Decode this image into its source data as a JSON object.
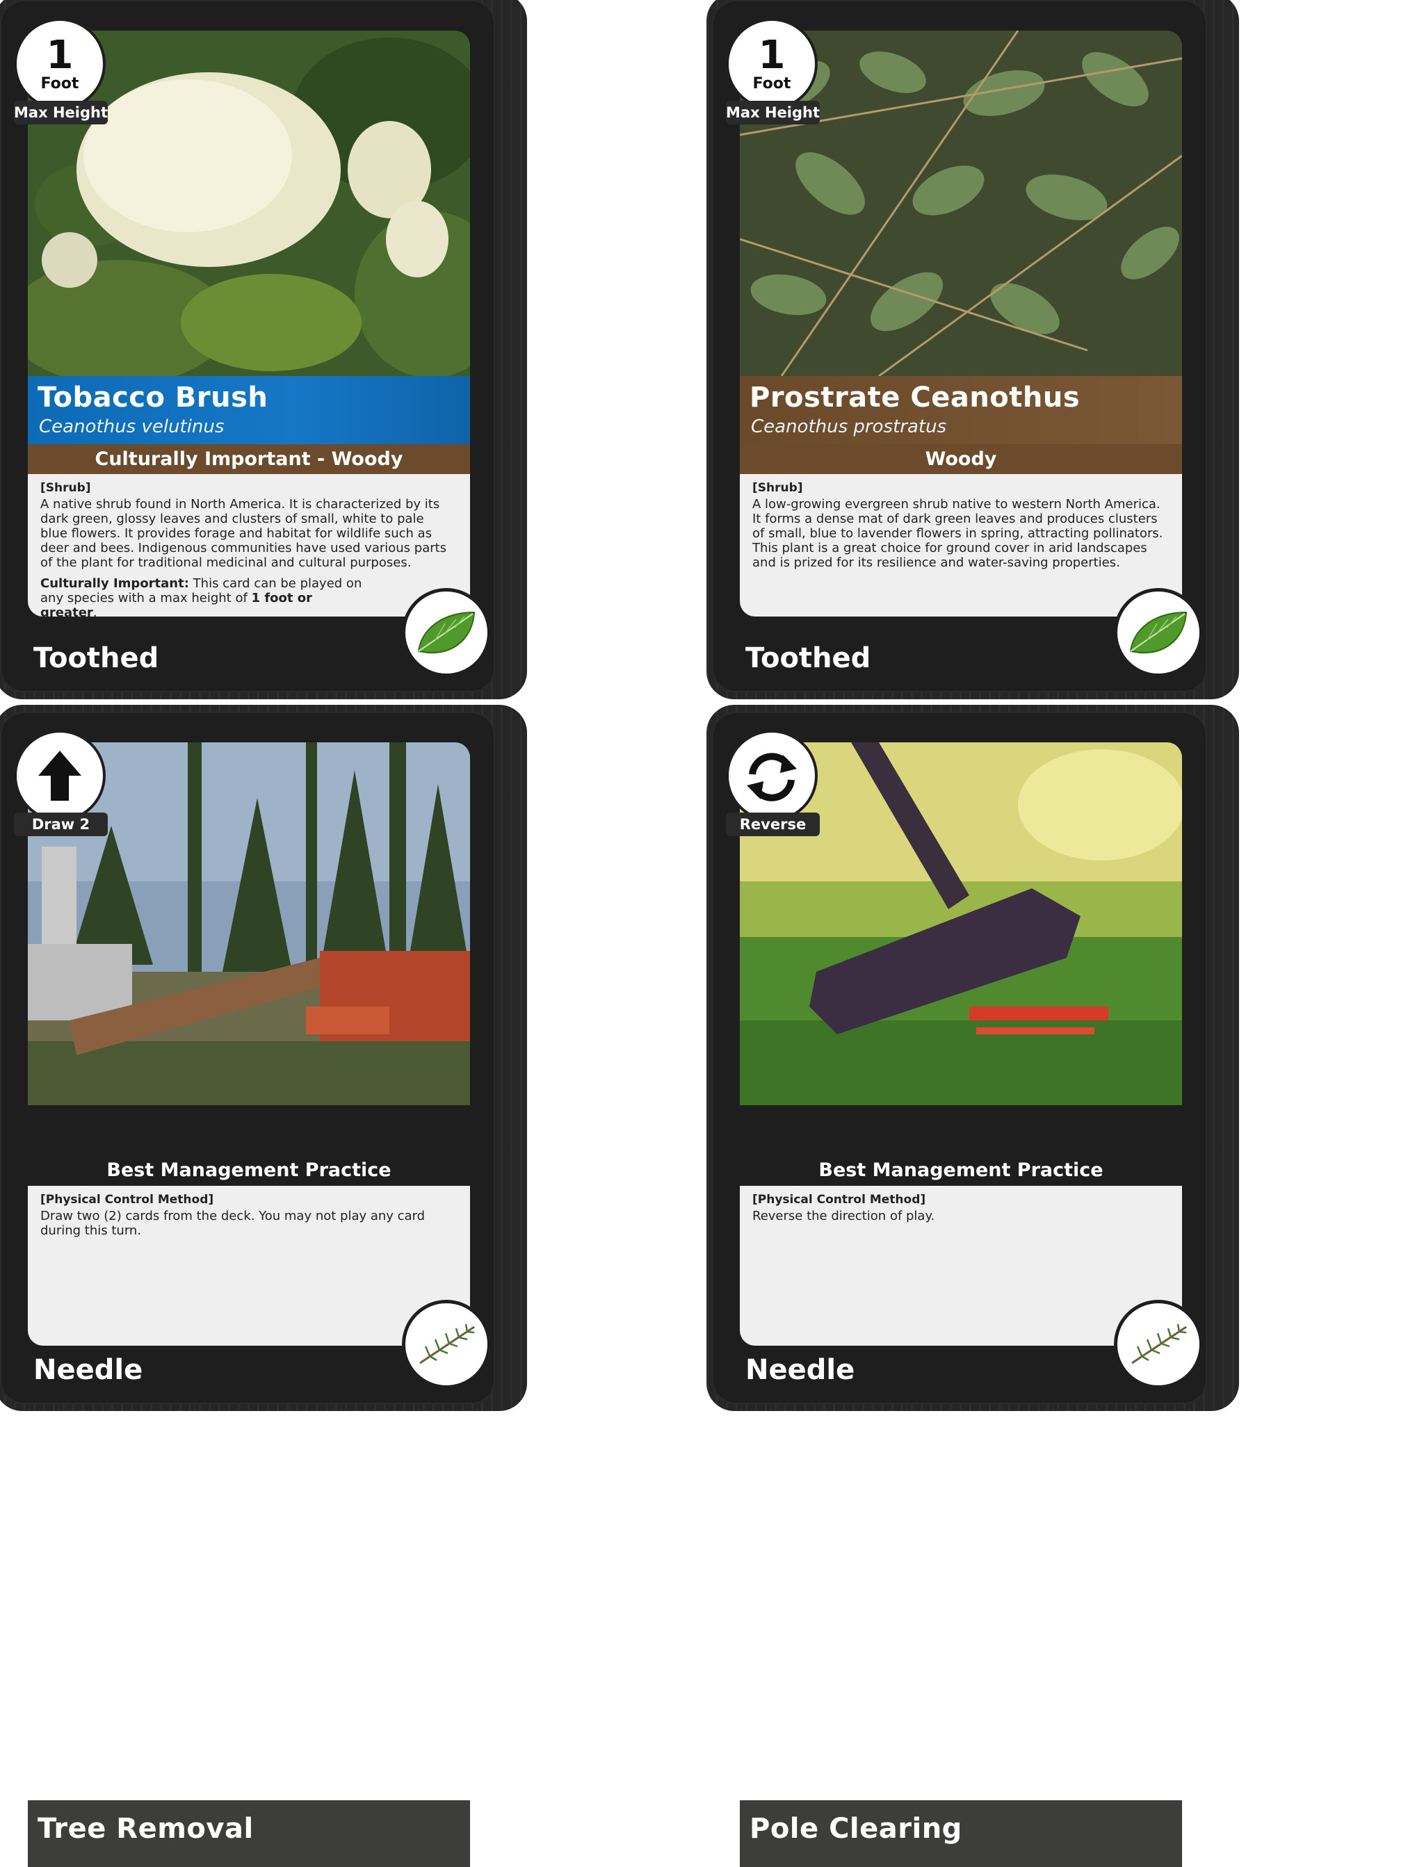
{
  "cards": [
    {
      "badge": {
        "value": "1",
        "unit": "Foot",
        "label": "Max Height"
      },
      "name": "Tobacco Brush",
      "scientific_name": "Ceanothus velutinus",
      "category": "Culturally Important - Woody",
      "type": "[Shrub]",
      "description": "A native shrub found in North America. It is characterized by its dark green, glossy leaves and clusters of small, white to pale blue flowers. It provides forage and habitat for wildlife such as deer and bees. Indigenous communities have used various parts of the plant for traditional medicinal and cultural purposes.",
      "special": {
        "label": "Culturally Important:",
        "text_before": " This card can be played on any species with a max height of ",
        "bold": "1 foot or greater",
        "text_after": "."
      },
      "leaf_type": "Toothed",
      "emblem_icon": "toothed-leaf-icon",
      "title_color": "#1577c6"
    },
    {
      "badge": {
        "value": "1",
        "unit": "Foot",
        "label": "Max Height"
      },
      "name": "Prostrate Ceanothus",
      "scientific_name": "Ceanothus prostratus",
      "category": "Woody",
      "type": "[Shrub]",
      "description": "A low-growing evergreen shrub native to western North America. It forms a dense mat of dark green leaves and produces clusters of small, blue to lavender flowers in spring, attracting pollinators. This plant is a great choice for ground cover in arid landscapes and is prized for its resilience and water-saving properties.",
      "leaf_type": "Toothed",
      "emblem_icon": "toothed-leaf-icon",
      "title_color": "#7a5836"
    },
    {
      "badge": {
        "icon": "arrow-up-icon",
        "label": "Draw 2"
      },
      "name": "Tree Removal",
      "category": "Best Management Practice",
      "type": "[Physical Control Method]",
      "description": "Draw two (2) cards from the deck. You may not play any card during this turn.",
      "leaf_type": "Needle",
      "emblem_icon": "needle-sprig-icon"
    },
    {
      "badge": {
        "icon": "reverse-arrows-icon",
        "label": "Reverse"
      },
      "name": "Pole Clearing",
      "category": "Best Management Practice",
      "type": "[Physical Control Method]",
      "description": "Reverse the direction of play.",
      "leaf_type": "Needle",
      "emblem_icon": "needle-sprig-icon"
    }
  ]
}
